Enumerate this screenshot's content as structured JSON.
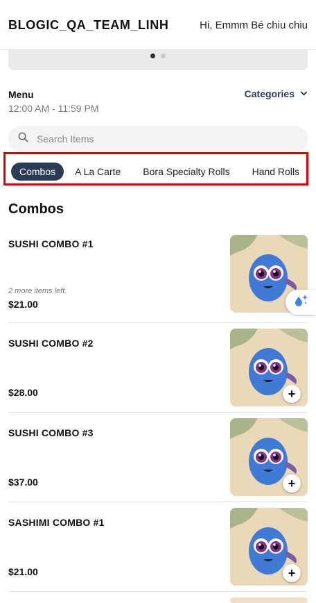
{
  "header": {
    "brand": "BLOGIC_QA_TEAM_LINH",
    "greeting": "Hi, Emmm Bé chiu chiu"
  },
  "menu": {
    "title": "Menu",
    "hours": "12:00 AM - 11:59 PM",
    "categories_label": "Categories"
  },
  "search": {
    "placeholder": "Search Items"
  },
  "tabs": [
    {
      "label": "Combos",
      "active": true
    },
    {
      "label": "A La Carte",
      "active": false
    },
    {
      "label": "Bora Specialty Rolls",
      "active": false
    },
    {
      "label": "Hand Rolls",
      "active": false
    }
  ],
  "section": {
    "title": "Combos"
  },
  "items": [
    {
      "name": "SUSHI COMBO #1",
      "note": "2 more items left.",
      "price": "$21.00"
    },
    {
      "name": "SUSHI COMBO #2",
      "note": "",
      "price": "$28.00"
    },
    {
      "name": "SUSHI COMBO #3",
      "note": "",
      "price": "$37.00"
    },
    {
      "name": "SASHIMI COMBO #1",
      "note": "",
      "price": "$21.00"
    }
  ],
  "add_symbol": "+",
  "icons": {
    "search": "search-icon",
    "chevron": "chevron-down-icon",
    "floating": "sparkle-drop-icon"
  },
  "colors": {
    "accent": "#2b3a55",
    "highlight_border": "#e00000"
  }
}
